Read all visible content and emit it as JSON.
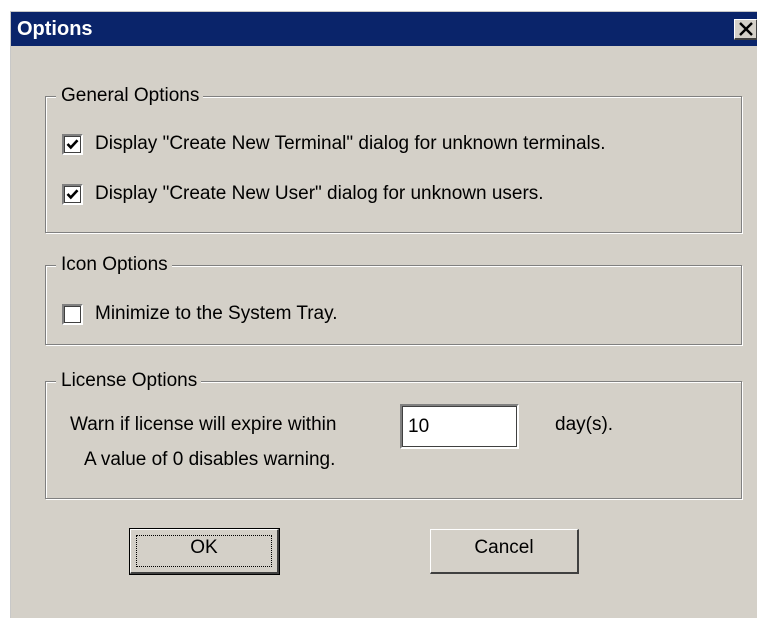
{
  "window": {
    "title": "Options"
  },
  "colors": {
    "titlebar": "#0a246a",
    "face": "#d4d0c8",
    "field": "#ffffff"
  },
  "icons": {
    "close": "close-x-icon",
    "check": "checkmark-icon"
  },
  "general_options": {
    "legend": "General Options",
    "items": [
      {
        "label": "Display \"Create New Terminal\" dialog for unknown terminals.",
        "checked": true
      },
      {
        "label": "Display \"Create New User\" dialog for unknown users.",
        "checked": true
      }
    ]
  },
  "icon_options": {
    "legend": "Icon Options",
    "items": [
      {
        "label": "Minimize to the System Tray.",
        "checked": false
      }
    ]
  },
  "license_options": {
    "legend": "License Options",
    "warn_label": "Warn if license will expire within",
    "days_value": "10",
    "days_unit": "day(s).",
    "hint": "A value of 0 disables warning."
  },
  "buttons": {
    "ok": "OK",
    "cancel": "Cancel"
  }
}
